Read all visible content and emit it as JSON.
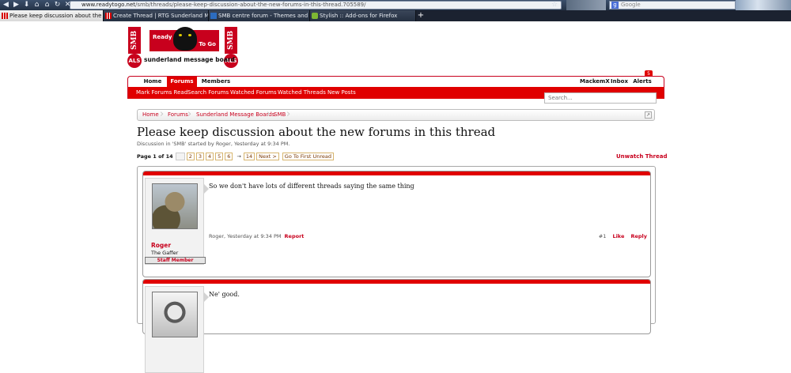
{
  "browser": {
    "url_host": "www.readytogo.net",
    "url_path": "/smb/threads/please-keep-discussion-about-the-new-forums-in-this-thread.705589/",
    "search_placeholder": "Google",
    "tabs": [
      {
        "label": "Please keep discussion about the new...",
        "active": true,
        "icon": "rtg-favicon"
      },
      {
        "label": "Create Thread | RTG Sunderland Messag...",
        "active": false,
        "icon": "rtg-favicon"
      },
      {
        "label": "SMB centre forum - Themes and Skins f...",
        "active": false,
        "icon": "smb-favicon"
      },
      {
        "label": "Stylish :: Add-ons for Firefox",
        "active": false,
        "icon": "stylish-favicon"
      }
    ],
    "new_tab": "+"
  },
  "logo": {
    "left_text": "SMB",
    "right_text": "SMB",
    "ready": "Ready",
    "to_go": "To Go",
    "board": "sunderland message board",
    "badge": "ALS"
  },
  "nav": {
    "tabs": [
      "Home",
      "Forums",
      "Members"
    ],
    "active_tab": "Forums",
    "account": "MackemX",
    "inbox": "Inbox",
    "alerts": "Alerts",
    "alerts_count": "5",
    "sub": [
      "Mark Forums Read",
      "Search Forums",
      "Watched Forums",
      "Watched Threads",
      "New Posts"
    ],
    "search_placeholder": "Search..."
  },
  "breadcrumb": [
    "Home",
    "Forums",
    "Sunderland Message Boards",
    "SMB"
  ],
  "thread": {
    "title": "Please keep discussion about the new forums in this thread",
    "meta": "Discussion in 'SMB' started by Roger, Yesterday at 9:34 PM.",
    "unwatch": "Unwatch Thread"
  },
  "pagenav": {
    "label": "Page 1 of 14",
    "pages": [
      "2",
      "3",
      "4",
      "5",
      "6"
    ],
    "arrow": "→",
    "last": "14",
    "next": "Next >",
    "first_unread": "Go To First Unread"
  },
  "posts": [
    {
      "username": "Roger",
      "user_title": "The Gaffer",
      "ribbon": "Staff Member",
      "text": "So we don't have lots of different threads saying the same thing",
      "meta": "Roger, Yesterday at 9:34 PM",
      "report": "Report",
      "number": "#1",
      "like": "Like",
      "reply": "Reply"
    },
    {
      "text": "Ne' good."
    }
  ]
}
